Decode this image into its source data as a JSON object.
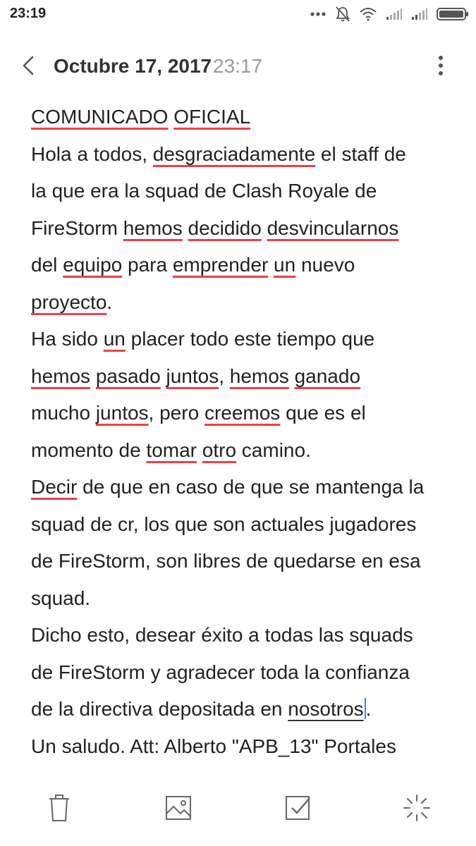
{
  "status_bar": {
    "time": "23:19",
    "icons": [
      "more-dots-icon",
      "notifications-muted-icon",
      "wifi-icon",
      "signal-icon",
      "signal-icon",
      "battery-icon"
    ]
  },
  "header": {
    "back_icon": "chevron-left-icon",
    "date": "Octubre 17, 2017",
    "time": "23:17",
    "more_icon": "vertical-dots-icon"
  },
  "note": {
    "lines": [
      [
        {
          "t": "COMUNICADO",
          "s": true
        },
        {
          "t": " "
        },
        {
          "t": "OFICIAL",
          "s": true
        }
      ],
      [
        {
          "t": "Hola a todos, "
        },
        {
          "t": "desgraciadamente",
          "s": true
        },
        {
          "t": " el staff de"
        }
      ],
      [
        {
          "t": "la que era la squad de Clash Royale de"
        }
      ],
      [
        {
          "t": "FireStorm "
        },
        {
          "t": "hemos",
          "s": true
        },
        {
          "t": " "
        },
        {
          "t": "decidido",
          "s": true
        },
        {
          "t": " "
        },
        {
          "t": "desvincularnos",
          "s": true
        }
      ],
      [
        {
          "t": "del "
        },
        {
          "t": "equipo",
          "s": true
        },
        {
          "t": " para "
        },
        {
          "t": "emprender",
          "s": true
        },
        {
          "t": " "
        },
        {
          "t": "un",
          "s": true
        },
        {
          "t": " nuevo"
        }
      ],
      [
        {
          "t": "proyecto",
          "s": true
        },
        {
          "t": "."
        }
      ],
      [
        {
          "t": "Ha sido "
        },
        {
          "t": "un",
          "s": true
        },
        {
          "t": " placer todo este tiempo que"
        }
      ],
      [
        {
          "t": "hemos",
          "s": true
        },
        {
          "t": " "
        },
        {
          "t": "pasado",
          "s": true
        },
        {
          "t": " "
        },
        {
          "t": "juntos",
          "s": true
        },
        {
          "t": ", "
        },
        {
          "t": "hemos",
          "s": true
        },
        {
          "t": " "
        },
        {
          "t": "ganado",
          "s": true
        }
      ],
      [
        {
          "t": "mucho "
        },
        {
          "t": "juntos",
          "s": true
        },
        {
          "t": ", pero "
        },
        {
          "t": "creemos",
          "s": true
        },
        {
          "t": " que es el"
        }
      ],
      [
        {
          "t": "momento de "
        },
        {
          "t": "tomar",
          "s": true
        },
        {
          "t": " "
        },
        {
          "t": "otro",
          "s": true
        },
        {
          "t": " camino."
        }
      ],
      [
        {
          "t": "Decir",
          "s": true
        },
        {
          "t": " de que en caso de que se mantenga la"
        }
      ],
      [
        {
          "t": "squad de cr, los que son actuales jugadores"
        }
      ],
      [
        {
          "t": "de FireStorm, son libres de quedarse en esa"
        }
      ],
      [
        {
          "t": "squad."
        }
      ],
      [
        {
          "t": "Dicho esto, desear éxito a todas las squads"
        }
      ],
      [
        {
          "t": "de FireStorm y agradecer toda la confianza"
        }
      ],
      [
        {
          "t": "de la directiva depositada en "
        },
        {
          "t": "nosotros",
          "d": true
        },
        {
          "t": ".",
          "c": true
        }
      ],
      [
        {
          "t": "Un saludo. Att: Alberto \"APB_13\" Portales"
        }
      ]
    ]
  },
  "toolbar": {
    "items": [
      {
        "name": "delete-button",
        "icon": "trash-icon"
      },
      {
        "name": "insert-image-button",
        "icon": "image-icon"
      },
      {
        "name": "checklist-button",
        "icon": "checkbox-icon"
      },
      {
        "name": "magic-button",
        "icon": "sparkle-icon"
      }
    ]
  }
}
